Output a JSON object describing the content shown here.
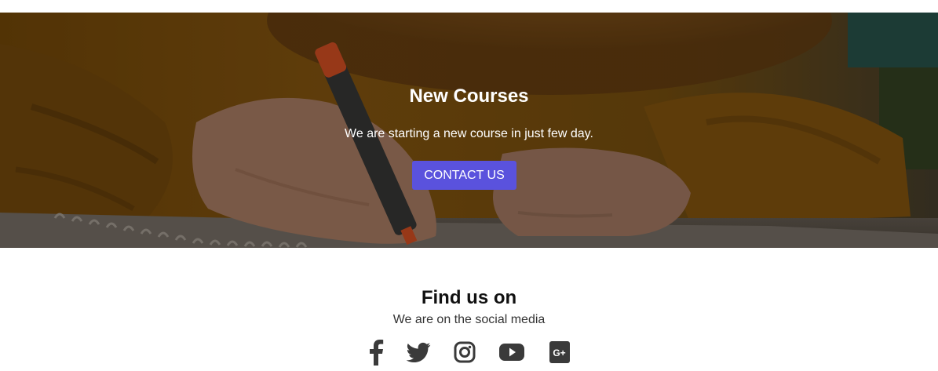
{
  "hero": {
    "title": "New Courses",
    "subtitle": "We are starting a new course in just few day.",
    "button_label": "CONTACT US",
    "button_color": "#5a52dd"
  },
  "find_us": {
    "title": "Find us on",
    "subtitle": "We are on the social media",
    "social_links": [
      {
        "icon": "facebook-icon"
      },
      {
        "icon": "twitter-icon"
      },
      {
        "icon": "instagram-icon"
      },
      {
        "icon": "youtube-icon"
      },
      {
        "icon": "google-plus-icon"
      }
    ],
    "icon_color": "#3a3a3a"
  }
}
